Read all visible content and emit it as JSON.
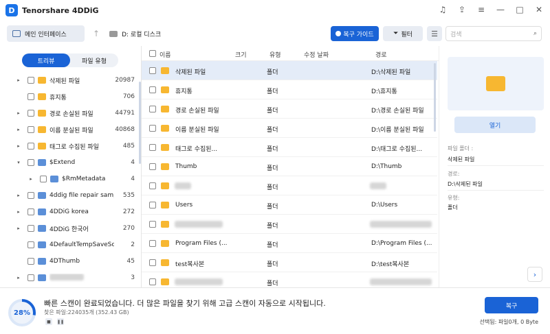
{
  "app": {
    "title": "Tenorshare 4DDiG"
  },
  "toolbar": {
    "home_label": "메인 인터페이스",
    "drive_label": "D: 로컬 디스크",
    "recovery_guide_label": "복구 가이드",
    "filter_label": "필터",
    "search_placeholder": "검색"
  },
  "tree": {
    "tabs": [
      "트리뷰",
      "파일 유형"
    ],
    "active_tab": "트리뷰",
    "items": [
      {
        "label": "삭제된 파일",
        "count": "20987",
        "color": "#f7b731",
        "expander": "▸",
        "depth": 0
      },
      {
        "label": "휴지통",
        "count": "706",
        "color": "#f7b731",
        "expander": "",
        "depth": 0
      },
      {
        "label": "경로 손실된 파일",
        "count": "44791",
        "color": "#f7b731",
        "expander": "▸",
        "depth": 0
      },
      {
        "label": "이름 분실된 파일",
        "count": "40868",
        "color": "#f7b731",
        "expander": "▸",
        "depth": 0
      },
      {
        "label": "태그로 수집된 파일",
        "count": "485",
        "color": "#f7b731",
        "expander": "▸",
        "depth": 0
      },
      {
        "label": "$Extend",
        "count": "4",
        "color": "#5b8fd8",
        "expander": "▾",
        "depth": 0
      },
      {
        "label": "$RmMetadata",
        "count": "4",
        "color": "#5b8fd8",
        "expander": "▸",
        "depth": 1
      },
      {
        "label": "4ddig file repair sample",
        "count": "535",
        "color": "#5b8fd8",
        "expander": "▸",
        "depth": 0
      },
      {
        "label": "4DDiG korea",
        "count": "272",
        "color": "#5b8fd8",
        "expander": "▸",
        "depth": 0
      },
      {
        "label": "4DDiG 한국어",
        "count": "270",
        "color": "#5b8fd8",
        "expander": "▸",
        "depth": 0
      },
      {
        "label": "4DefaultTempSaveScan",
        "count": "2",
        "color": "#5b8fd8",
        "expander": "",
        "depth": 0
      },
      {
        "label": "4DThumb",
        "count": "45",
        "color": "#5b8fd8",
        "expander": "",
        "depth": 0
      },
      {
        "label": "",
        "count": "3",
        "color": "#5b8fd8",
        "expander": "▸",
        "depth": 0
      }
    ]
  },
  "list": {
    "headers": [
      "이름",
      "크기",
      "유형",
      "수정 날짜",
      "경로"
    ],
    "rows": [
      {
        "name": "삭제된 파일",
        "type": "폴더",
        "path": "D:\\삭제된 파일",
        "selected": true
      },
      {
        "name": "휴지통",
        "type": "폴더",
        "path": "D:\\휴지통",
        "selected": false
      },
      {
        "name": "경로 손실된 파일",
        "type": "폴더",
        "path": "D:\\경로 손실된 파일",
        "selected": false
      },
      {
        "name": "이름 분실된 파일",
        "type": "폴더",
        "path": "D:\\이름 분실된 파일",
        "selected": false
      },
      {
        "name": "태그로 수집된...",
        "type": "폴더",
        "path": "D:\\태그로 수집된...",
        "selected": false
      },
      {
        "name": "Thumb",
        "type": "폴더",
        "path": "D:\\Thumb",
        "selected": false
      },
      {
        "name": "",
        "type": "폴더",
        "path": "",
        "selected": false
      },
      {
        "name": "Users",
        "type": "폴더",
        "path": "D:\\Users",
        "selected": false
      },
      {
        "name": "",
        "type": "폴더",
        "path": "",
        "selected": false
      },
      {
        "name": "Program Files (...",
        "type": "폴더",
        "path": "D:\\Program Files (...",
        "selected": false
      },
      {
        "name": "test복사본",
        "type": "폴더",
        "path": "D:\\test복사본",
        "selected": false
      },
      {
        "name": "",
        "type": "폴더",
        "path": "",
        "selected": false
      }
    ]
  },
  "detail": {
    "open_label": "열기",
    "folder_label": "파일 폴더 :",
    "folder_value": "삭제된 파일",
    "path_label": "경로:",
    "path_value": "D:\\삭제된 파일",
    "type_label": "유형:",
    "type_value": "폴더"
  },
  "status": {
    "progress": "28%",
    "progress_value": 28,
    "message": "빠른 스캔이 완료되었습니다. 더 많은 파일을 찾기 위해 고급 스캔이 자동으로 시작됩니다.",
    "found": "찾은 파일:224035개 (352.43 GB)",
    "recover_label": "복구",
    "selected": "선택됨: 파일0개, 0 Byte"
  },
  "colors": {
    "accent": "#1a63d6",
    "folder_yellow": "#f7b731",
    "folder_blue": "#5b8fd8"
  }
}
